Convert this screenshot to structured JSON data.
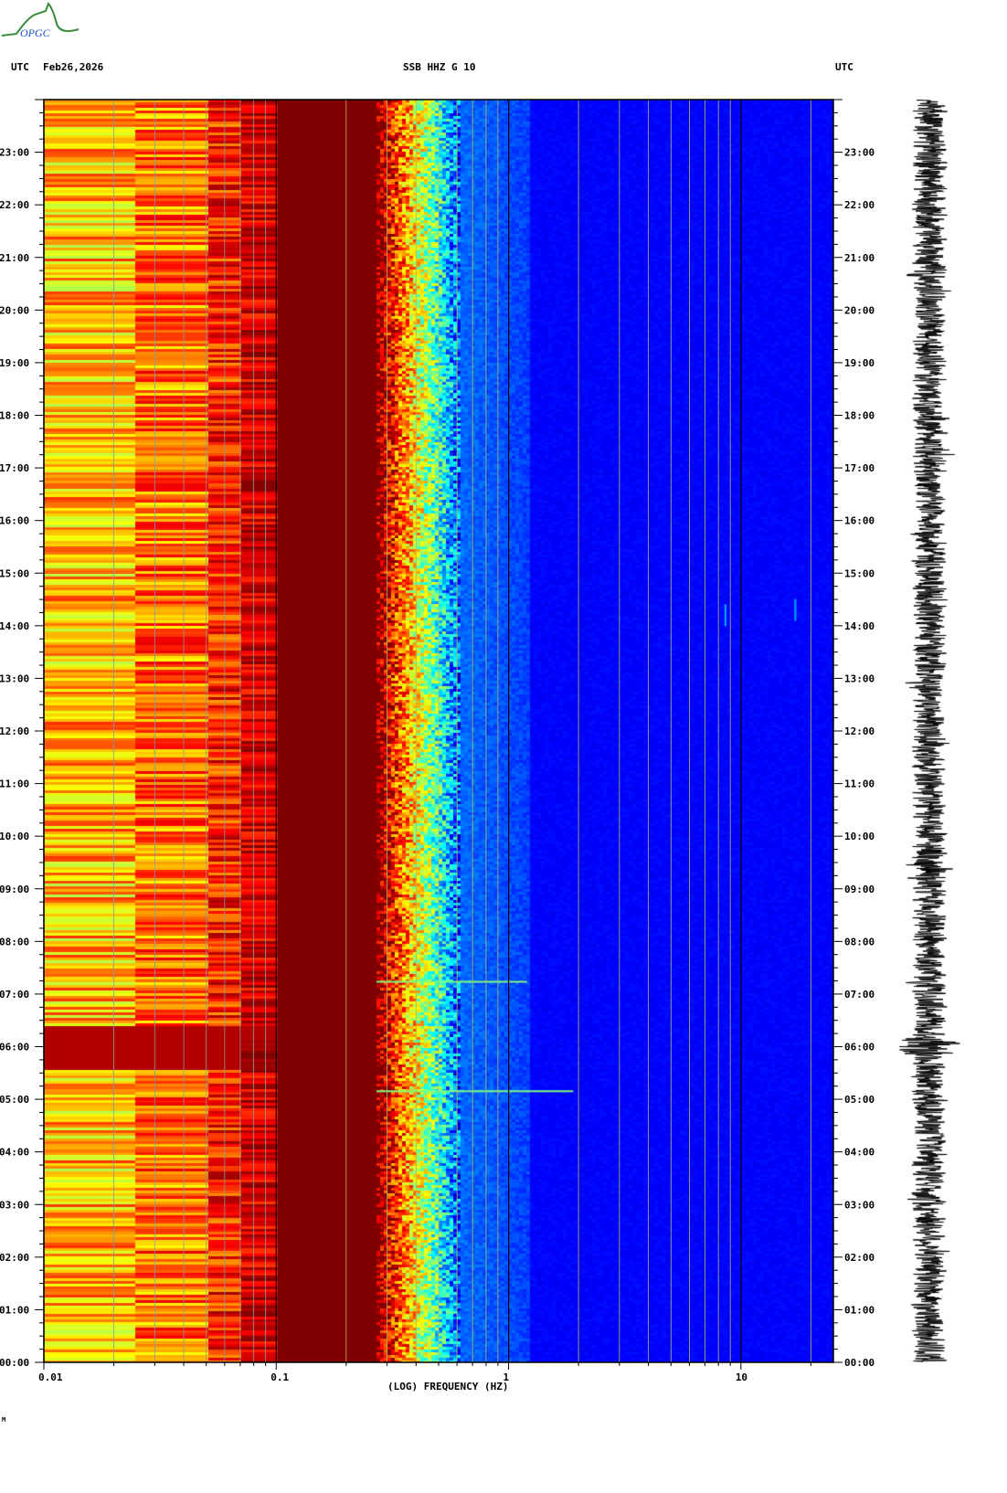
{
  "header": {
    "left_tz": "UTC",
    "date": "Feb26,2026",
    "station": "SSB HHZ G 10",
    "right_tz": "UTC",
    "logo_text": "OPGC",
    "footer_mark": "M"
  },
  "colors": {
    "background_low": "#00009f",
    "high": "#800000"
  },
  "chart_data": {
    "type": "heatmap",
    "title": "SSB HHZ G 10",
    "xlabel": "(LOG) FREQUENCY (HZ)",
    "ylabel": "UTC",
    "xscale": "log",
    "xlim": [
      0.01,
      25
    ],
    "ylim_hours": [
      0,
      24
    ],
    "x_ticks": [
      {
        "value": 0.01,
        "label": "0.01"
      },
      {
        "value": 0.1,
        "label": "0.1"
      },
      {
        "value": 1,
        "label": "1"
      },
      {
        "value": 10,
        "label": "10"
      }
    ],
    "y_ticks": [
      "00:00",
      "01:00",
      "02:00",
      "03:00",
      "04:00",
      "05:00",
      "06:00",
      "07:00",
      "08:00",
      "09:00",
      "10:00",
      "11:00",
      "12:00",
      "13:00",
      "14:00",
      "15:00",
      "16:00",
      "17:00",
      "18:00",
      "19:00",
      "20:00",
      "21:00",
      "22:00",
      "23:00"
    ],
    "colormap": "jet",
    "events": [
      {
        "time_hours": 5.17,
        "max_freq_hz": 1.9,
        "note": "broadband horizontal streak"
      },
      {
        "time_hours": 7.25,
        "max_freq_hz": 1.2
      },
      {
        "time_hours": 14.2,
        "freq_hz": 8.5
      },
      {
        "time_hours": 14.3,
        "freq_hz": 17
      }
    ],
    "trace": {
      "description_label": "seismogram",
      "peak_time_hours": 6.0
    }
  }
}
